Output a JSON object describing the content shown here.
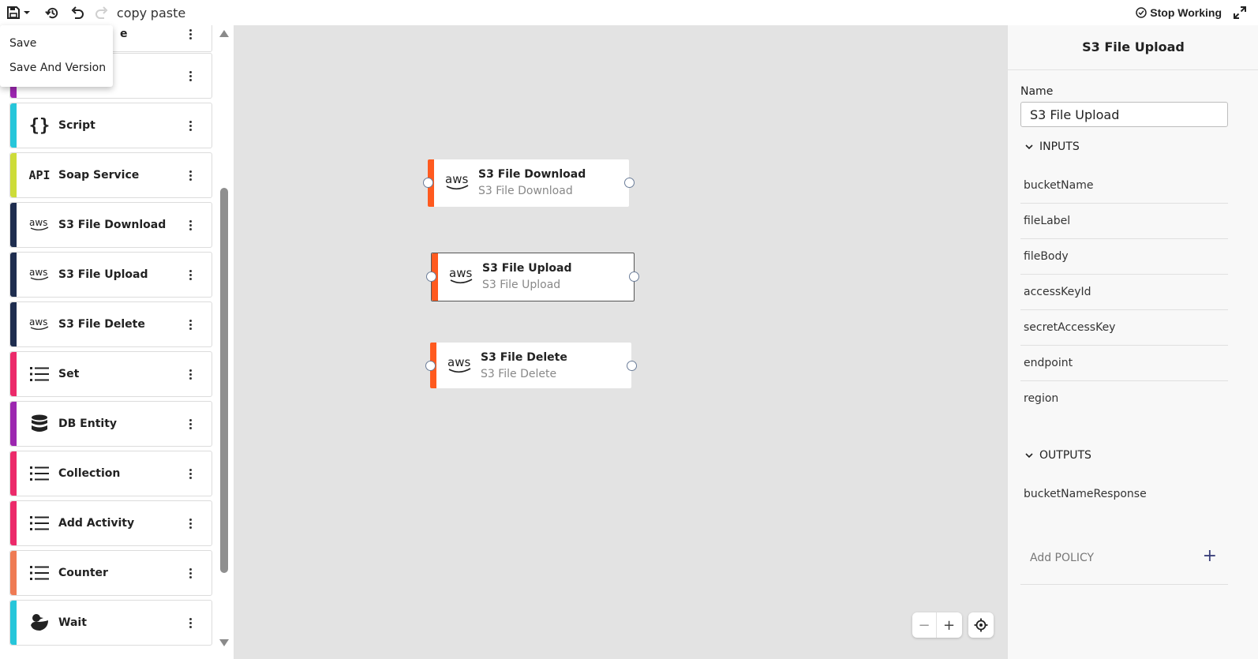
{
  "toolbar": {
    "save_icon": "save-icon",
    "history_icon": "history-icon",
    "undo_icon": "undo-icon",
    "redo_icon": "redo-icon",
    "copy_label": "copy",
    "paste_label": "paste",
    "stop_working_label": "Stop Working",
    "expand_icon": "expand-icon"
  },
  "save_menu": {
    "items": [
      "Save",
      "Save And Version"
    ]
  },
  "palette": {
    "items": [
      {
        "label": "Script",
        "icon": "braces-icon",
        "color": "#26c6da"
      },
      {
        "label": "Soap Service",
        "icon": "api-icon",
        "color": "#cddc39"
      },
      {
        "label": "S3 File Download",
        "icon": "aws-icon",
        "color": "#1e2d4f"
      },
      {
        "label": "S3 File Upload",
        "icon": "aws-icon",
        "color": "#1e2d4f"
      },
      {
        "label": "S3 File Delete",
        "icon": "aws-icon",
        "color": "#1e2d4f"
      },
      {
        "label": "Set",
        "icon": "list-icon",
        "color": "#ec2a6a"
      },
      {
        "label": "DB Entity",
        "icon": "database-icon",
        "color": "#9c27b0"
      },
      {
        "label": "Collection",
        "icon": "list-icon",
        "color": "#ec2a6a"
      },
      {
        "label": "Add Activity",
        "icon": "list-icon",
        "color": "#ec2a6a"
      },
      {
        "label": "Counter",
        "icon": "list-icon",
        "color": "#ef7b54"
      },
      {
        "label": "Wait",
        "icon": "duck-icon",
        "color": "#26c6da"
      }
    ],
    "partial_top_label": "e"
  },
  "canvas": {
    "nodes": [
      {
        "title": "S3 File Download",
        "subtitle": "S3 File Download"
      },
      {
        "title": "S3 File Upload",
        "subtitle": "S3 File Upload"
      },
      {
        "title": "S3 File Delete",
        "subtitle": "S3 File Delete"
      }
    ],
    "zoom_out_label": "−",
    "zoom_in_label": "+"
  },
  "panel": {
    "title": "S3 File Upload",
    "name_label": "Name",
    "name_value": "S3 File Upload",
    "inputs_label": "INPUTS",
    "inputs": [
      "bucketName",
      "fileLabel",
      "fileBody",
      "accessKeyId",
      "secretAccessKey",
      "endpoint",
      "region"
    ],
    "outputs_label": "OUTPUTS",
    "outputs": [
      "bucketNameResponse"
    ],
    "policy_label": "Add POLICY",
    "policy_add": "+"
  },
  "colors": {
    "node_strip": "#ff5a1f",
    "canvas_bg": "#e3e3e3",
    "aws_navy": "#1e2d4f"
  }
}
